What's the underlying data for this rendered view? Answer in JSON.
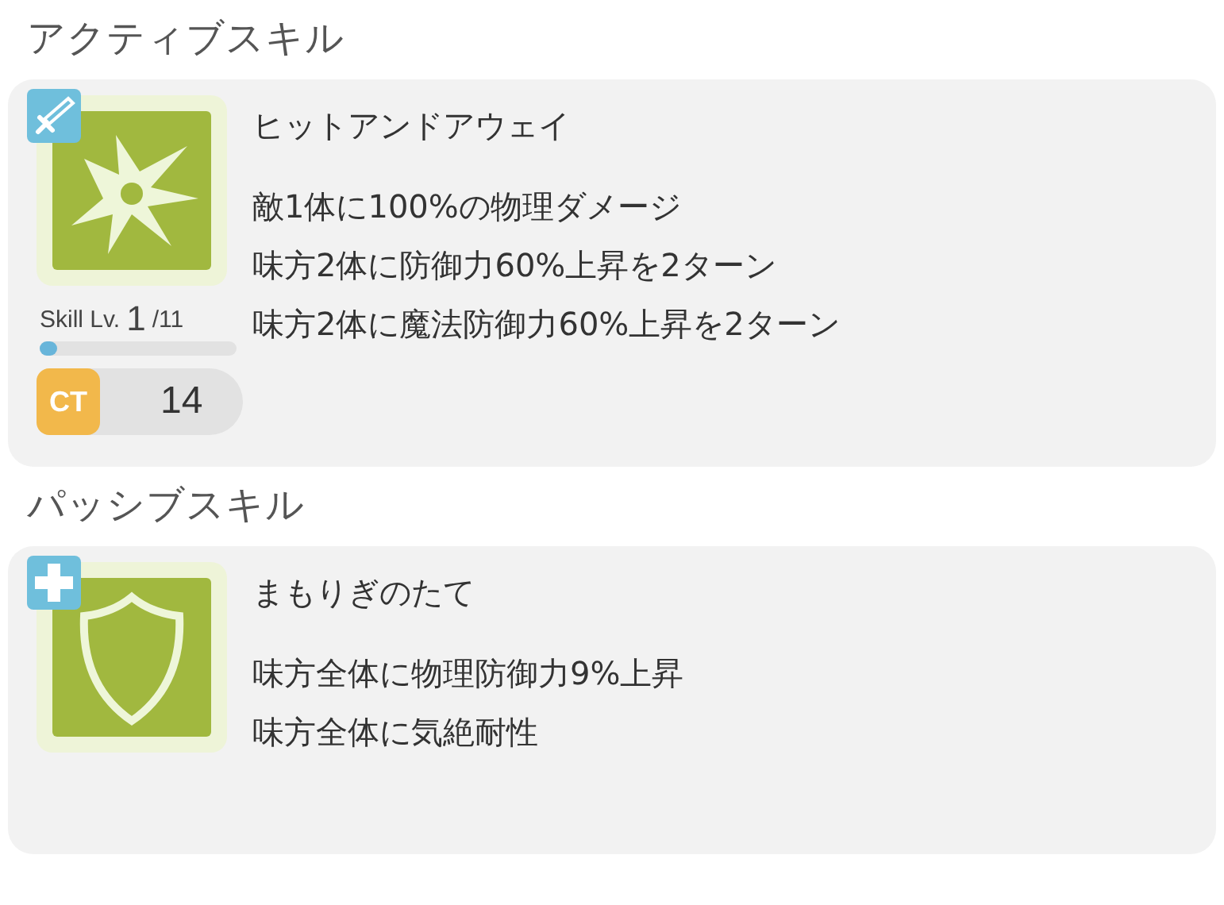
{
  "sections": [
    {
      "heading": "アクティブスキル",
      "skill": {
        "badge": {
          "kind": "sword"
        },
        "art": {
          "kind": "burst"
        },
        "name": "ヒットアンドアウェイ",
        "effects": [
          "敵1体に100%の物理ダメージ",
          "味方2体に防御力60%上昇を2ターン",
          "味方2体に魔法防御力60%上昇を2ターン"
        ],
        "skill_level": {
          "label": "Skill Lv.",
          "current": "1",
          "max": "/11",
          "level": 0.09
        },
        "cooldown": {
          "label": "CT",
          "value": "14"
        }
      }
    },
    {
      "heading": "パッシブスキル",
      "skill": {
        "badge": {
          "kind": "plus"
        },
        "art": {
          "kind": "shield"
        },
        "name": "まもりぎのたて",
        "effects": [
          "味方全体に物理防御力9%上昇",
          "味方全体に気絶耐性"
        ]
      }
    }
  ]
}
